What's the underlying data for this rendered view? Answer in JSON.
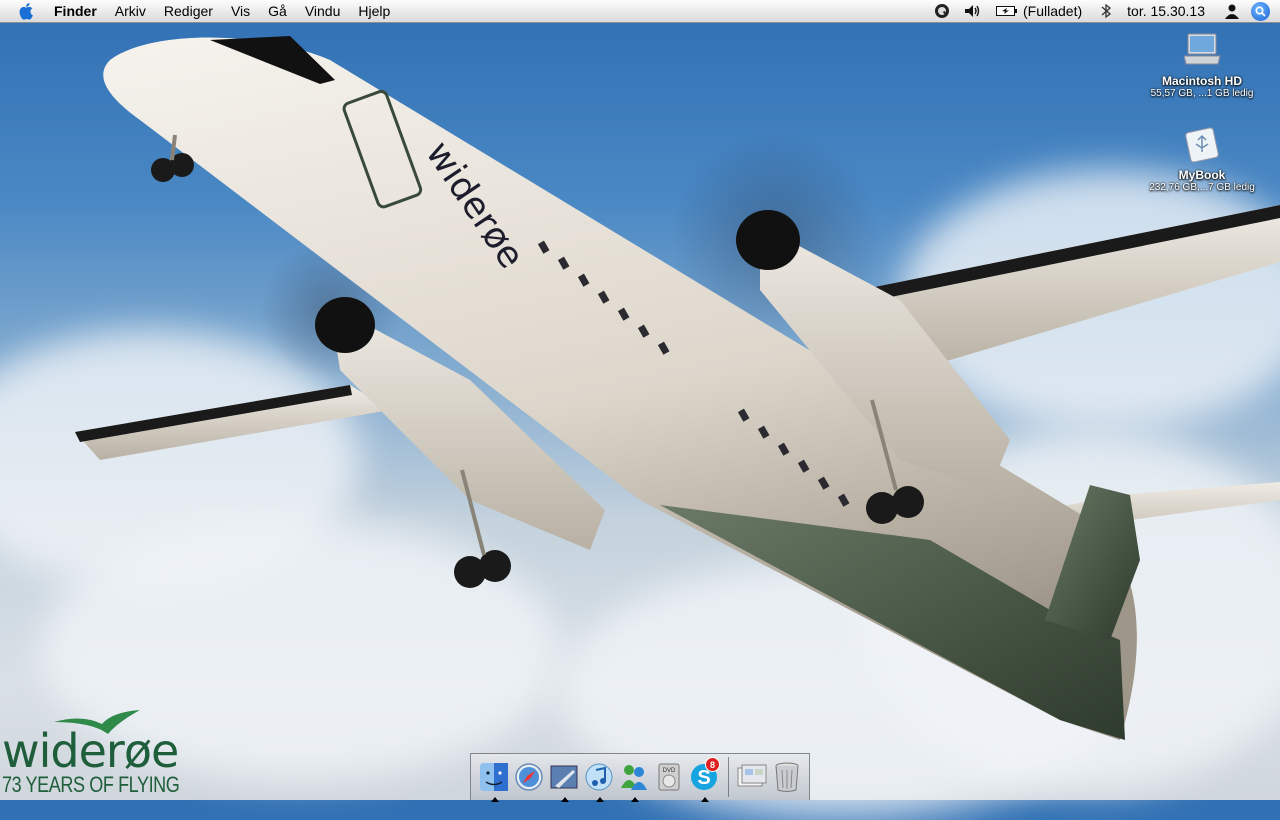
{
  "menubar": {
    "app_name": "Finder",
    "items": [
      "Arkiv",
      "Rediger",
      "Vis",
      "Gå",
      "Vindu",
      "Hjelp"
    ],
    "battery_status": "(Fulladet)",
    "clock": "tor. 15.30.13"
  },
  "desktop_icons": [
    {
      "name": "Macintosh HD",
      "info": "55,57 GB, ...1 GB ledig",
      "icon": "hard-drive-icon"
    },
    {
      "name": "MyBook",
      "info": "232,76 GB,...7 GB ledig",
      "icon": "usb-drive-icon"
    }
  ],
  "aircraft": {
    "livery_text": "widerøe"
  },
  "wallpaper_logo": {
    "word": "widerøe",
    "tagline": "73 YEARS OF FLYING"
  },
  "dock": {
    "items": [
      {
        "name": "finder-icon",
        "running": true
      },
      {
        "name": "safari-icon",
        "running": false
      },
      {
        "name": "mail-icon",
        "running": true
      },
      {
        "name": "itunes-icon",
        "running": true
      },
      {
        "name": "msn-messenger-icon",
        "running": true
      },
      {
        "name": "dvd-player-icon",
        "running": false
      },
      {
        "name": "skype-icon",
        "running": true,
        "badge": "8"
      }
    ],
    "right_items": [
      {
        "name": "stacks-folder-icon"
      },
      {
        "name": "trash-icon"
      }
    ]
  },
  "colors": {
    "brand_green": "#1f5e3b",
    "sky_blue": "#3b7bbf",
    "spotlight_blue": "#1a63d6"
  }
}
